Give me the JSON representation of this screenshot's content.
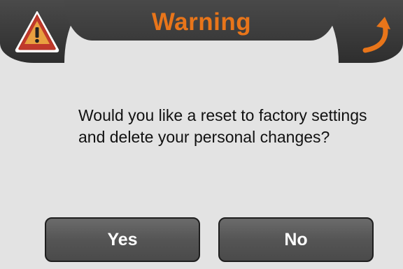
{
  "dialog": {
    "title": "Warning",
    "message": "Would you like a reset to factory settings and delete your personal changes?",
    "title_color": "#e8751a",
    "icons": {
      "left": "warning-triangle-icon",
      "right": "back-arrow-icon"
    }
  },
  "buttons": {
    "yes_label": "Yes",
    "no_label": "No"
  }
}
